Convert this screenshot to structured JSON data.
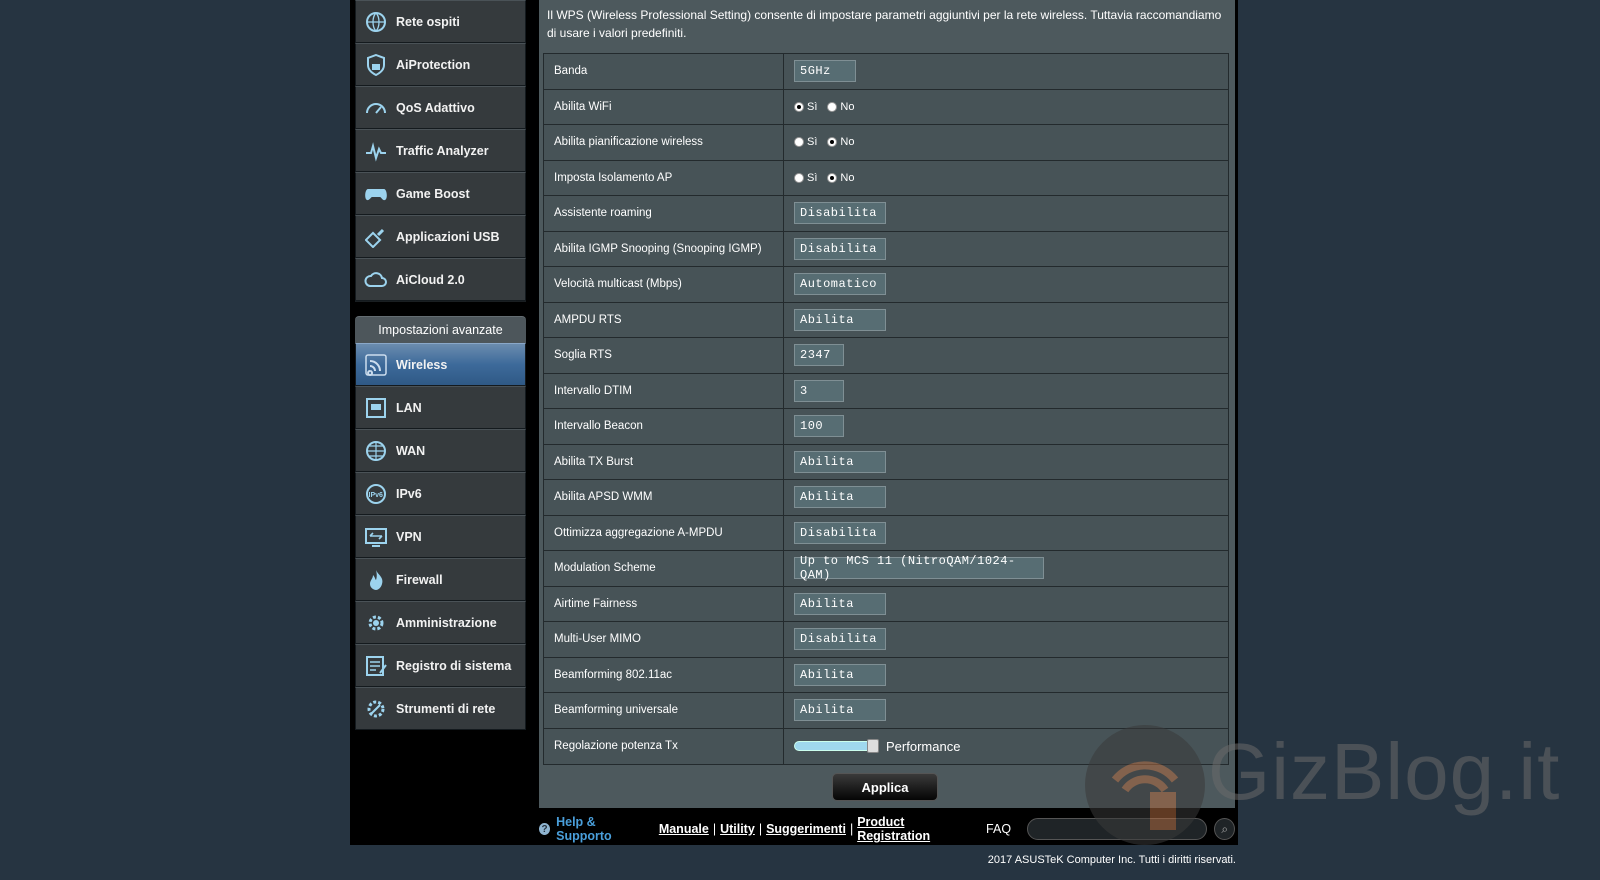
{
  "sidebar": {
    "top_items": [
      {
        "label": "Rete ospiti",
        "icon": "globe-people-icon"
      },
      {
        "label": "AiProtection",
        "icon": "lock-shield-icon"
      },
      {
        "label": "QoS Adattivo",
        "icon": "gauge-icon"
      },
      {
        "label": "Traffic Analyzer",
        "icon": "heartbeat-icon"
      },
      {
        "label": "Game Boost",
        "icon": "gamepad-icon"
      },
      {
        "label": "Applicazioni USB",
        "icon": "usb-icon"
      },
      {
        "label": "AiCloud 2.0",
        "icon": "cloud-icon"
      }
    ],
    "advanced_header": "Impostazioni avanzate",
    "advanced_items": [
      {
        "label": "Wireless",
        "icon": "wifi-icon",
        "active": true
      },
      {
        "label": "LAN",
        "icon": "lan-icon"
      },
      {
        "label": "WAN",
        "icon": "globe-icon"
      },
      {
        "label": "IPv6",
        "icon": "ipv6-icon"
      },
      {
        "label": "VPN",
        "icon": "vpn-icon"
      },
      {
        "label": "Firewall",
        "icon": "fire-icon"
      },
      {
        "label": "Amministrazione",
        "icon": "gear-person-icon"
      },
      {
        "label": "Registro di sistema",
        "icon": "log-icon"
      },
      {
        "label": "Strumenti di rete",
        "icon": "tools-gear-icon"
      }
    ]
  },
  "intro": "Il WPS (Wireless Professional Setting) consente di impostare parametri aggiuntivi per la rete wireless. Tuttavia raccomandiamo di usare i valori predefiniti.",
  "settings": {
    "band": {
      "label": "Banda",
      "value": "5GHz"
    },
    "wifi": {
      "label": "Abilita WiFi",
      "yes": "Sì",
      "no": "No",
      "selected": "yes"
    },
    "schedule": {
      "label": "Abilita pianificazione wireless",
      "yes": "Sì",
      "no": "No",
      "selected": "no"
    },
    "ap_isolation": {
      "label": "Imposta Isolamento AP",
      "yes": "Sì",
      "no": "No",
      "selected": "no"
    },
    "roaming": {
      "label": "Assistente roaming",
      "value": "Disabilita"
    },
    "igmp": {
      "label": "Abilita IGMP Snooping (Snooping IGMP)",
      "value": "Disabilita"
    },
    "multicast": {
      "label": "Velocità multicast (Mbps)",
      "value": "Automatico"
    },
    "ampdu_rts": {
      "label": "AMPDU RTS",
      "value": "Abilita"
    },
    "rts": {
      "label": "Soglia RTS",
      "value": "2347"
    },
    "dtim": {
      "label": "Intervallo DTIM",
      "value": "3"
    },
    "beacon": {
      "label": "Intervallo Beacon",
      "value": "100"
    },
    "tx_burst": {
      "label": "Abilita TX Burst",
      "value": "Abilita"
    },
    "apsd": {
      "label": "Abilita APSD WMM",
      "value": "Abilita"
    },
    "ampdu_opt": {
      "label": "Ottimizza aggregazione A-MPDU",
      "value": "Disabilita"
    },
    "modulation": {
      "label": "Modulation Scheme",
      "value": "Up to MCS 11 (NitroQAM/1024-QAM)"
    },
    "airtime": {
      "label": "Airtime Fairness",
      "value": "Abilita"
    },
    "mumimo": {
      "label": "Multi-User MIMO",
      "value": "Disabilita"
    },
    "bf_ac": {
      "label": "Beamforming 802.11ac",
      "value": "Abilita"
    },
    "bf_uni": {
      "label": "Beamforming universale",
      "value": "Abilita"
    },
    "txpower": {
      "label": "Regolazione potenza Tx",
      "value": "Performance",
      "level": 1.0
    }
  },
  "apply_label": "Applica",
  "footer": {
    "help": "Help & Supporto",
    "links": [
      "Manuale",
      "Utility",
      "Suggerimenti",
      "Product Registration"
    ],
    "faq": "FAQ",
    "copyright": "2017 ASUSTeK Computer Inc. Tutti i diritti riservati."
  },
  "watermark": "GizBlog.it",
  "colors": {
    "accent": "#4a9fdb",
    "active_nav": "#3d6a9a",
    "panel": "#4d595d",
    "background": "#263441"
  }
}
